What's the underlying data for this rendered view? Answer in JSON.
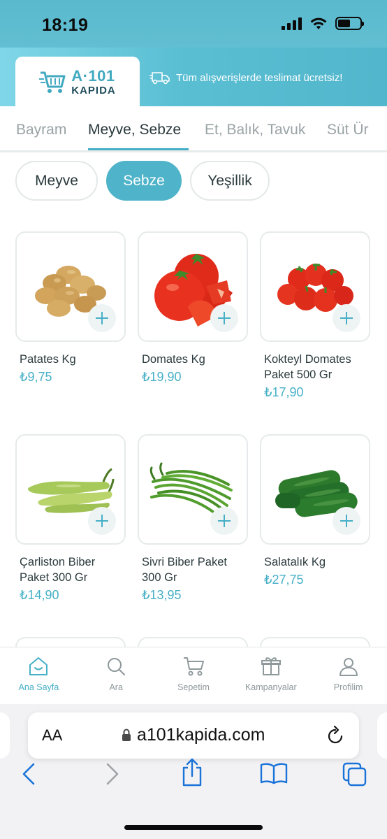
{
  "status_bar": {
    "time": "18:19"
  },
  "header": {
    "logo_brand": "A·101",
    "logo_sub": "KAPIDA",
    "promo_text": "Tüm alışverişlerde teslimat ücretsiz!"
  },
  "category_tabs": [
    {
      "label": "Bayram",
      "active": false
    },
    {
      "label": "Meyve, Sebze",
      "active": true
    },
    {
      "label": "Et, Balık, Tavuk",
      "active": false
    },
    {
      "label": "Süt Ür",
      "active": false
    }
  ],
  "sub_tabs": [
    {
      "label": "Meyve",
      "active": false
    },
    {
      "label": "Sebze",
      "active": true
    },
    {
      "label": "Yeşillik",
      "active": false
    }
  ],
  "products": [
    {
      "name": "Patates Kg",
      "price": "₺9,75",
      "icon": "potato-image"
    },
    {
      "name": "Domates Kg",
      "price": "₺19,90",
      "icon": "tomato-image"
    },
    {
      "name": "Kokteyl Domates Paket 500 Gr",
      "price": "₺17,90",
      "icon": "cherry-tomato-image"
    },
    {
      "name": "Çarliston Biber Paket 300 Gr",
      "price": "₺14,90",
      "icon": "charleston-pepper-image"
    },
    {
      "name": "Sivri Biber Paket 300 Gr",
      "price": "₺13,95",
      "icon": "green-pepper-image"
    },
    {
      "name": "Salatalık Kg",
      "price": "₺27,75",
      "icon": "cucumber-image"
    }
  ],
  "bottom_nav": [
    {
      "label": "Ana Sayfa",
      "icon": "home-icon",
      "active": true
    },
    {
      "label": "Ara",
      "icon": "search-icon",
      "active": false
    },
    {
      "label": "Sepetim",
      "icon": "cart-icon",
      "active": false
    },
    {
      "label": "Kampanyalar",
      "icon": "gift-icon",
      "active": false
    },
    {
      "label": "Profilim",
      "icon": "profile-icon",
      "active": false
    }
  ],
  "browser": {
    "text_size_label": "AA",
    "url": "a101kapida.com"
  },
  "colors": {
    "accent": "#47b0c7",
    "header_teal": "#5bbfd3",
    "text_dark": "#2b3a3d",
    "text_muted": "#9aa3a6"
  }
}
